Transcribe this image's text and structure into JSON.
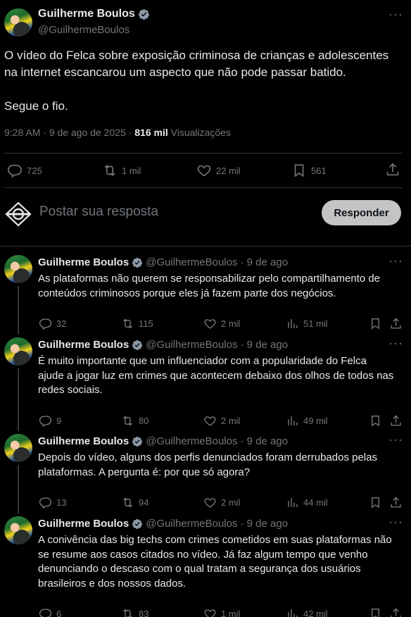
{
  "main": {
    "author_name": "Guilherme Boulos",
    "author_handle": "@GuilhermeBoulos",
    "text_lines": [
      "O vídeo do Felca sobre exposição criminosa de crianças e adolescentes",
      "na internet escancarou um aspecto que não pode passar batido."
    ],
    "text_line2": "Segue o fio.",
    "timestamp": "9:28 AM · 9 de ago de 2025 · ",
    "views_count": "816 mil",
    "views_label": " Visualizações",
    "stats": {
      "replies": "725",
      "retweets": "1 mil",
      "likes": "22 mil",
      "bookmarks": "561"
    }
  },
  "reply_box": {
    "placeholder": "Postar sua resposta",
    "button_label": "Responder"
  },
  "thread": [
    {
      "name": "Guilherme Boulos",
      "handle": "@GuilhermeBoulos",
      "time": "· 9 de ago",
      "text_lines": [
        "As plataformas não querem se responsabilizar pelo compartilhamento de",
        "conteúdos criminosos porque eles já fazem parte dos negócios."
      ],
      "replies": "32",
      "retweets": "115",
      "likes": "2 mil",
      "views": "51 mil"
    },
    {
      "name": "Guilherme Boulos",
      "handle": "@GuilhermeBoulos",
      "time": "· 9 de ago",
      "text_lines": [
        "É muito importante que um influenciador com a popularidade do Felca",
        "ajude a jogar luz em crimes que acontecem debaixo dos olhos de todos nas",
        "redes sociais."
      ],
      "replies": "9",
      "retweets": "80",
      "likes": "2 mil",
      "views": "49 mil"
    },
    {
      "name": "Guilherme Boulos",
      "handle": "@GuilhermeBoulos",
      "time": "· 9 de ago",
      "text_lines": [
        "Depois do vídeo, alguns dos perfis denunciados foram derrubados pelas",
        "plataformas. A pergunta é: por que só agora?"
      ],
      "replies": "13",
      "retweets": "94",
      "likes": "2 mil",
      "views": "44 mil"
    },
    {
      "name": "Guilherme Boulos",
      "handle": "@GuilhermeBoulos",
      "time": "· 9 de ago",
      "text_lines": [
        "A conivência das big techs com crimes cometidos em suas plataformas não",
        "se resume aos casos citados no vídeo. Já faz algum tempo que venho",
        "denunciando o descaso com o qual tratam a segurança dos usuários",
        "brasileiros e dos nossos dados."
      ],
      "replies": "6",
      "retweets": "83",
      "likes": "1 mil",
      "views": "42 mil"
    }
  ]
}
